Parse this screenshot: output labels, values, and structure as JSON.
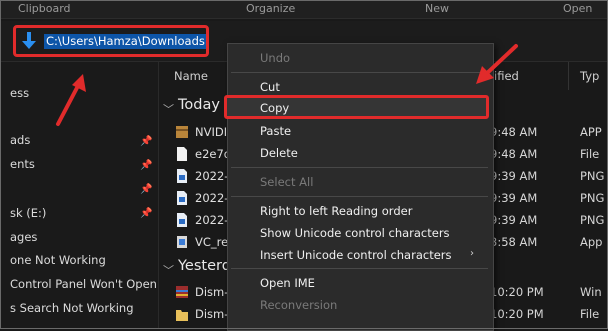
{
  "ribbon": {
    "labels": [
      "Clipboard",
      "Organize",
      "New",
      "Open"
    ]
  },
  "address": {
    "path": "C:\\Users\\Hamza\\Downloads",
    "icon": "down-arrow-icon"
  },
  "nav": {
    "items": [
      {
        "label": "ess",
        "pinned": false
      },
      {
        "label": "ads",
        "pinned": true
      },
      {
        "label": "ents",
        "pinned": true
      },
      {
        "label": "",
        "pinned": true
      },
      {
        "label": "sk (E:)",
        "pinned": true
      },
      {
        "label": "ages",
        "pinned": false
      },
      {
        "label": "one Not Working",
        "pinned": false
      },
      {
        "label": "Control Panel Won't Open",
        "pinned": false
      },
      {
        "label": "s Search Not Working",
        "pinned": false
      }
    ]
  },
  "columns": {
    "name": "Name",
    "modified": "ified",
    "type": "Typ"
  },
  "groups": {
    "today": "Today",
    "yesterday": "Yesterd"
  },
  "files": [
    {
      "name": "NVIDI",
      "time": "9:48 AM",
      "type": "APP",
      "icon": "package-icon"
    },
    {
      "name": "e2e7d",
      "time": "9:48 AM",
      "type": "File",
      "icon": "file-icon"
    },
    {
      "name": "2022-",
      "time": "9:39 AM",
      "type": "PNG",
      "icon": "image-file-icon"
    },
    {
      "name": "2022-",
      "time": "9:39 AM",
      "type": "PNG",
      "icon": "image-file-icon"
    },
    {
      "name": "2022-",
      "time": "9:39 AM",
      "type": "PNG",
      "icon": "image-file-icon"
    },
    {
      "name": "VC_re",
      "time": "3:58 AM",
      "type": "App",
      "icon": "installer-icon"
    }
  ],
  "files_yesterday": [
    {
      "name": "Dism-",
      "time": "10:20 PM",
      "type": "Win",
      "icon": "archive-icon"
    },
    {
      "name": "Dism-",
      "time": "10:20 PM",
      "type": "File",
      "icon": "folder-icon"
    }
  ],
  "menu": {
    "undo": "Undo",
    "cut": "Cut",
    "copy": "Copy",
    "paste": "Paste",
    "delete": "Delete",
    "select_all": "Select All",
    "rtl": "Right to left Reading order",
    "show_unicode": "Show Unicode control characters",
    "insert_unicode": "Insert Unicode control characters",
    "open_ime": "Open IME",
    "reconversion": "Reconversion"
  },
  "watermark": "A  PUALS",
  "colors": {
    "highlight_red": "#e12b2b",
    "selection_blue": "#0d55a8",
    "menu_bg": "#2b2b2b"
  }
}
